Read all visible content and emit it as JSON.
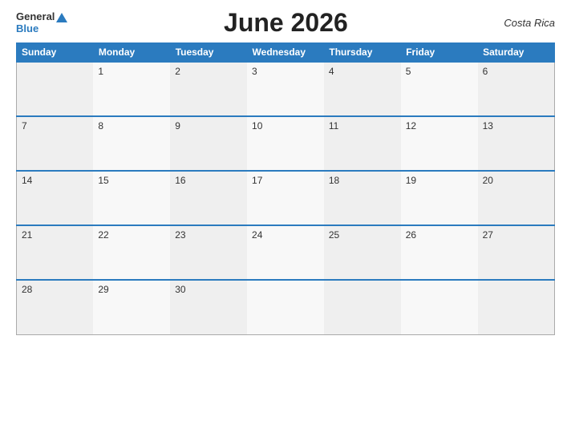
{
  "header": {
    "logo_general": "General",
    "logo_blue": "Blue",
    "title": "June 2026",
    "country": "Costa Rica"
  },
  "days_of_week": [
    "Sunday",
    "Monday",
    "Tuesday",
    "Wednesday",
    "Thursday",
    "Friday",
    "Saturday"
  ],
  "weeks": [
    [
      "",
      "1",
      "2",
      "3",
      "4",
      "5",
      "6"
    ],
    [
      "7",
      "8",
      "9",
      "10",
      "11",
      "12",
      "13"
    ],
    [
      "14",
      "15",
      "16",
      "17",
      "18",
      "19",
      "20"
    ],
    [
      "21",
      "22",
      "23",
      "24",
      "25",
      "26",
      "27"
    ],
    [
      "28",
      "29",
      "30",
      "",
      "",
      "",
      ""
    ]
  ]
}
